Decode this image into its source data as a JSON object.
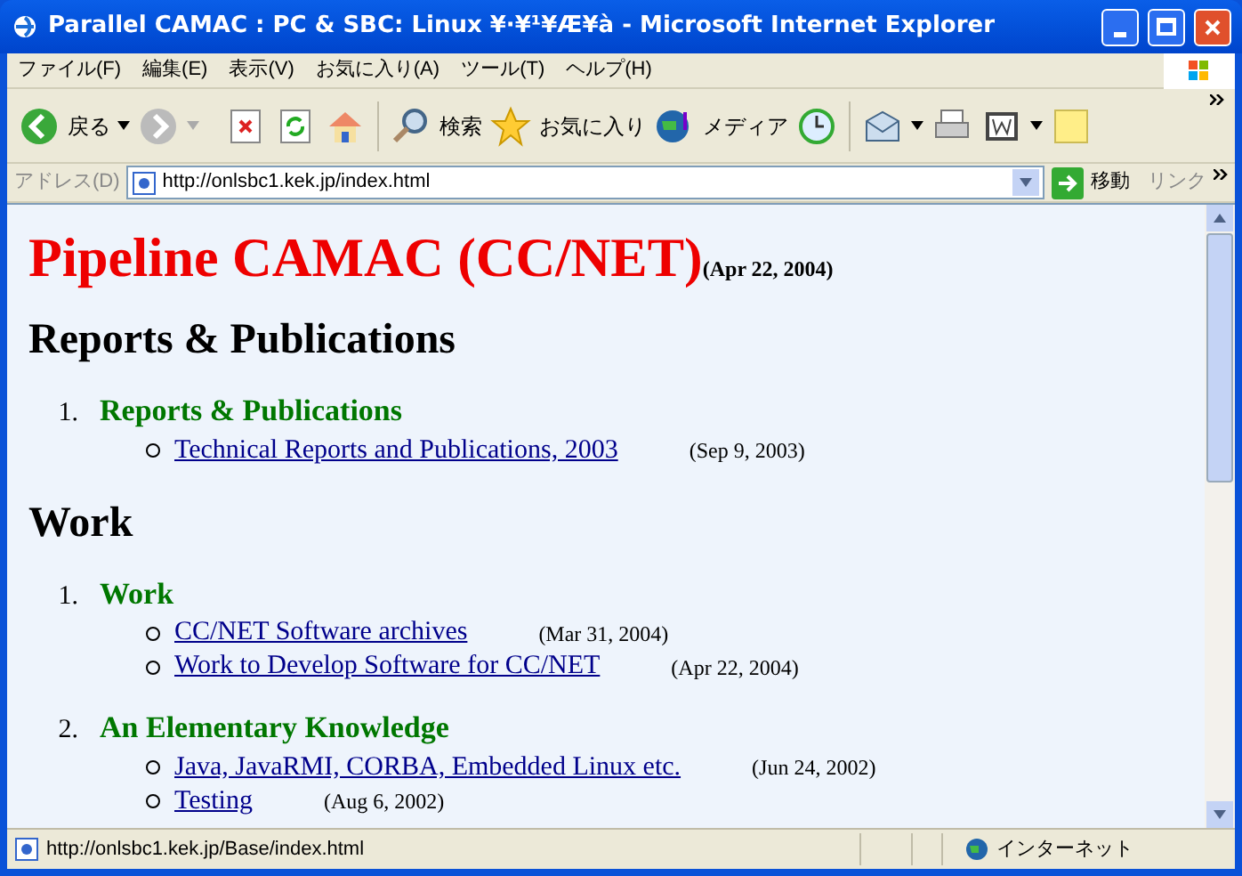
{
  "window": {
    "title": "Parallel CAMAC : PC & SBC: Linux ¥·¥¹¥Æ¥à - Microsoft Internet Explorer"
  },
  "menu": [
    "ファイル(F)",
    "編集(E)",
    "表示(V)",
    "お気に入り(A)",
    "ツール(T)",
    "ヘルプ(H)"
  ],
  "toolbar": {
    "back": "戻る",
    "search": "検索",
    "favorites": "お気に入り",
    "media": "メディア"
  },
  "address_bar": {
    "label": "アドレス(D)",
    "value": "http://onlsbc1.kek.jp/index.html",
    "go": "移動",
    "links": "リンク"
  },
  "page": {
    "title": "Pipeline CAMAC (CC/NET)",
    "title_date": "(Apr 22, 2004)",
    "sections": [
      {
        "heading": "Reports & Publications",
        "items": [
          {
            "number": "1.",
            "title": "Reports & Publications",
            "links": [
              {
                "text": "Technical Reports and Publications, 2003",
                "date": "(Sep 9, 2003)"
              }
            ]
          }
        ]
      },
      {
        "heading": "Work",
        "items": [
          {
            "number": "1.",
            "title": "Work",
            "links": [
              {
                "text": "CC/NET Software archives",
                "date": "(Mar 31, 2004)"
              },
              {
                "text": "Work to Develop Software for CC/NET",
                "date": "(Apr 22, 2004)"
              }
            ]
          },
          {
            "number": "2.",
            "title": "An Elementary Knowledge",
            "links": [
              {
                "text": "Java, JavaRMI, CORBA, Embedded Linux etc.",
                "date": "(Jun 24, 2002)"
              },
              {
                "text": "Testing",
                "date": "(Aug 6, 2002)"
              }
            ]
          }
        ]
      }
    ]
  },
  "status_bar": {
    "url": "http://onlsbc1.kek.jp/Base/index.html",
    "zone": "インターネット"
  }
}
